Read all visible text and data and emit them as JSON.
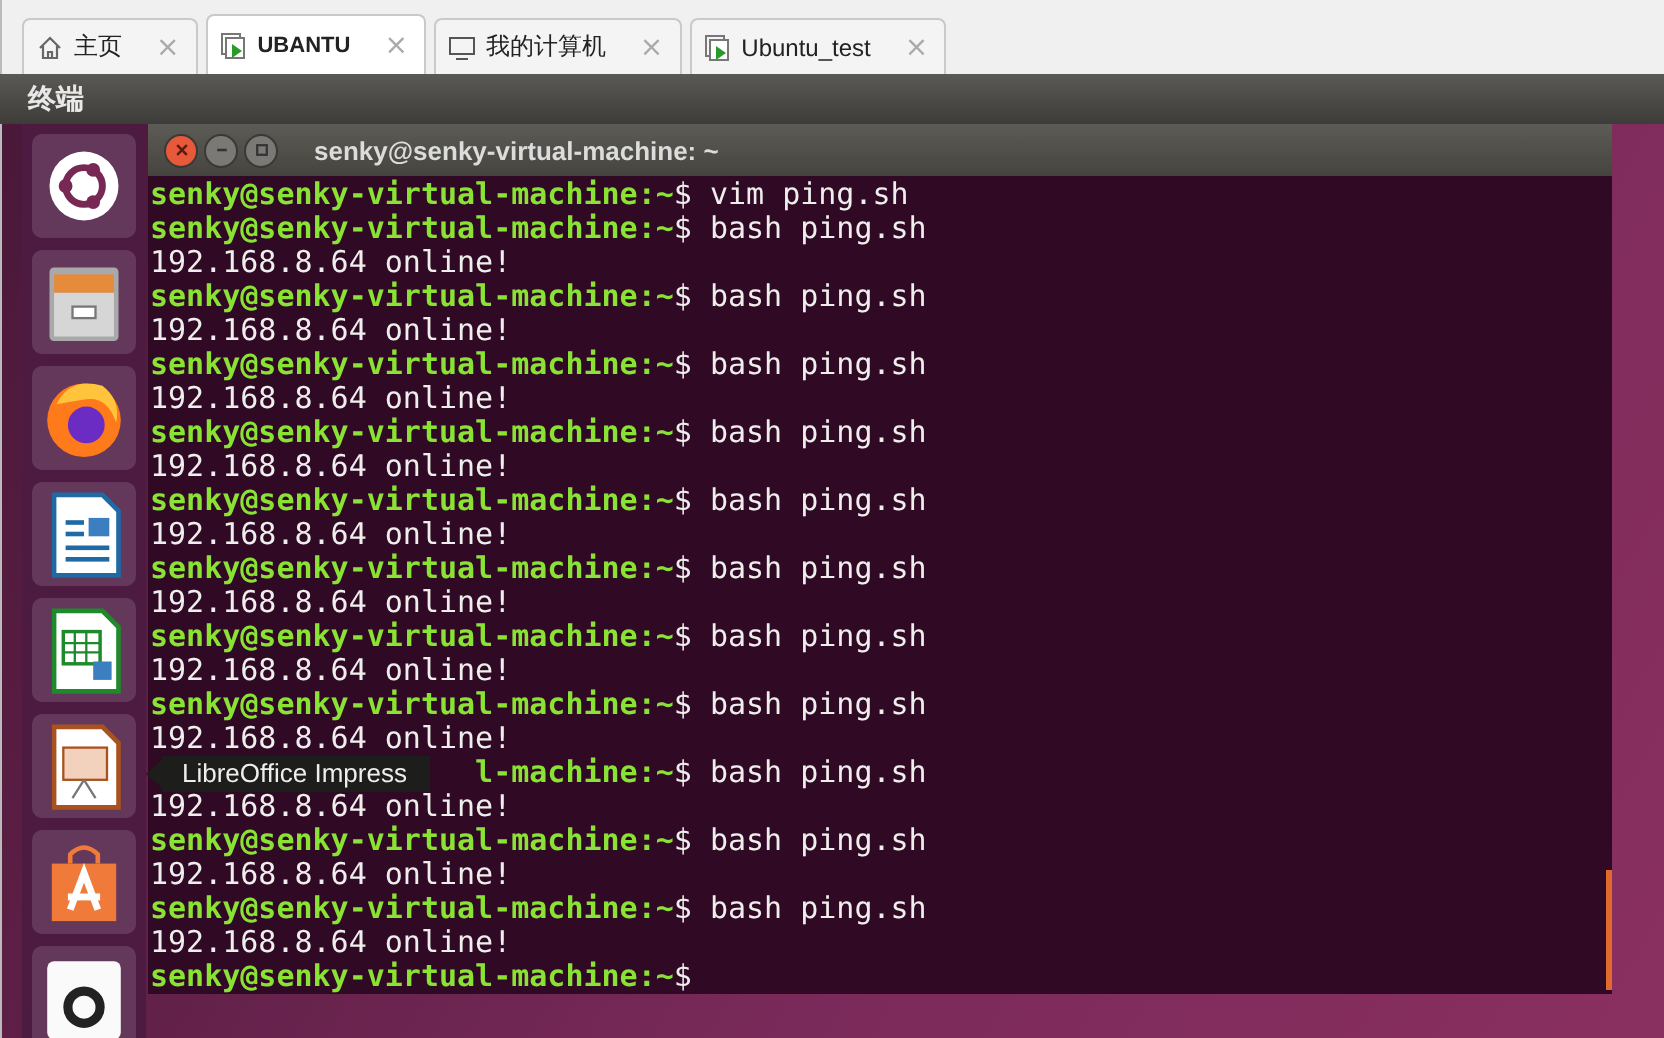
{
  "tabs": [
    {
      "label": "主页",
      "kind": "home",
      "selected": false,
      "close": "×"
    },
    {
      "label": "UBANTU",
      "kind": "vm",
      "selected": true,
      "close": "×"
    },
    {
      "label": "我的计算机",
      "kind": "computer",
      "selected": false,
      "close": "×"
    },
    {
      "label": "Ubuntu_test",
      "kind": "vm",
      "selected": false,
      "close": "×"
    }
  ],
  "app_bar": {
    "title": "终端"
  },
  "launcher": {
    "items": [
      {
        "kind": "ubuntu"
      },
      {
        "kind": "files"
      },
      {
        "kind": "firefox"
      },
      {
        "kind": "writer"
      },
      {
        "kind": "calc"
      },
      {
        "kind": "impress"
      },
      {
        "kind": "store"
      },
      {
        "kind": "amazon"
      }
    ],
    "tooltip": "LibreOffice Impress"
  },
  "terminal": {
    "title": "senky@senky-virtual-machine: ~",
    "lines": [
      {
        "kind": "prompt",
        "prompt": "senky@senky-virtual-machine:~",
        "command": "$ vim ping.sh"
      },
      {
        "kind": "prompt",
        "prompt": "senky@senky-virtual-machine:~",
        "command": "$ bash ping.sh"
      },
      {
        "kind": "output",
        "text": "192.168.8.64 online!"
      },
      {
        "kind": "prompt",
        "prompt": "senky@senky-virtual-machine:~",
        "command": "$ bash ping.sh"
      },
      {
        "kind": "output",
        "text": "192.168.8.64 online!"
      },
      {
        "kind": "prompt",
        "prompt": "senky@senky-virtual-machine:~",
        "command": "$ bash ping.sh"
      },
      {
        "kind": "output",
        "text": "192.168.8.64 online!"
      },
      {
        "kind": "prompt",
        "prompt": "senky@senky-virtual-machine:~",
        "command": "$ bash ping.sh"
      },
      {
        "kind": "output",
        "text": "192.168.8.64 online!"
      },
      {
        "kind": "prompt",
        "prompt": "senky@senky-virtual-machine:~",
        "command": "$ bash ping.sh"
      },
      {
        "kind": "output",
        "text": "192.168.8.64 online!"
      },
      {
        "kind": "prompt",
        "prompt": "senky@senky-virtual-machine:~",
        "command": "$ bash ping.sh"
      },
      {
        "kind": "output",
        "text": "192.168.8.64 online!"
      },
      {
        "kind": "prompt",
        "prompt": "senky@senky-virtual-machine:~",
        "command": "$ bash ping.sh"
      },
      {
        "kind": "output",
        "text": "192.168.8.64 online!"
      },
      {
        "kind": "prompt",
        "prompt": "senky@senky-virtual-machine:~",
        "command": "$ bash ping.sh"
      },
      {
        "kind": "output",
        "text": "192.168.8.64 online!"
      },
      {
        "kind": "covered",
        "prompt": "l-machine:~",
        "command": "$ bash ping.sh"
      },
      {
        "kind": "output",
        "text": "192.168.8.64 online!"
      },
      {
        "kind": "prompt",
        "prompt": "senky@senky-virtual-machine:~",
        "command": "$ bash ping.sh"
      },
      {
        "kind": "output",
        "text": "192.168.8.64 online!"
      },
      {
        "kind": "prompt",
        "prompt": "senky@senky-virtual-machine:~",
        "command": "$ bash ping.sh"
      },
      {
        "kind": "output",
        "text": "192.168.8.64 online!"
      },
      {
        "kind": "prompt",
        "prompt": "senky@senky-virtual-machine:~",
        "command": "$"
      }
    ]
  }
}
